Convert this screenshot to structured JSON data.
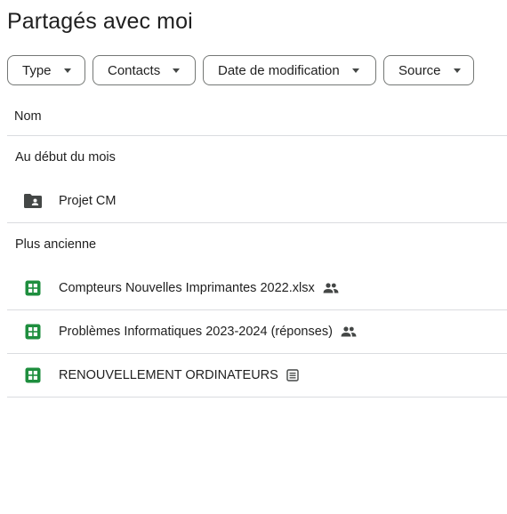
{
  "page": {
    "title": "Partagés avec moi"
  },
  "filters": [
    {
      "label": "Type"
    },
    {
      "label": "Contacts"
    },
    {
      "label": "Date de modification"
    },
    {
      "label": "Source"
    }
  ],
  "table": {
    "column_header": "Nom"
  },
  "groups": [
    {
      "label": "Au début du mois",
      "items": [
        {
          "name": "Projet CM",
          "icon": "shared-folder-icon",
          "badge": ""
        }
      ]
    },
    {
      "label": "Plus ancienne",
      "items": [
        {
          "name": "Compteurs Nouvelles Imprimantes 2022.xlsx",
          "icon": "google-sheets-icon",
          "badge": "shared-people-icon"
        },
        {
          "name": "Problèmes Informatiques 2023-2024 (réponses)",
          "icon": "google-sheets-icon",
          "badge": "shared-people-icon"
        },
        {
          "name": "RENOUVELLEMENT ORDINATEURS",
          "icon": "google-sheets-icon",
          "badge": "form-linked-icon"
        }
      ]
    }
  ],
  "colors": {
    "sheets_green": "#1e8e3e",
    "folder_dark": "#444746",
    "divider": "#dadce0",
    "chip_border": "#747775"
  }
}
